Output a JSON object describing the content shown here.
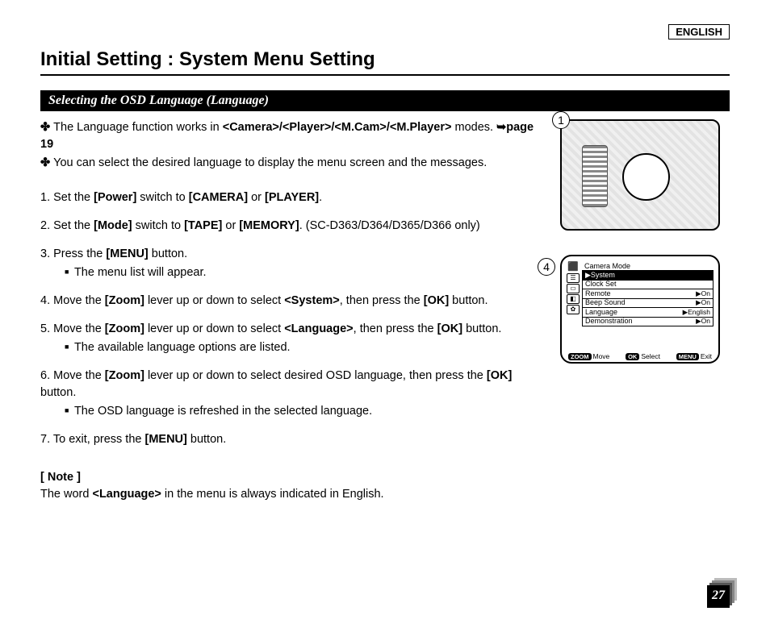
{
  "language_tag": "ENGLISH",
  "page_title": "Initial Setting : System Menu Setting",
  "section_title": "Selecting the OSD Language (Language)",
  "intro": {
    "line1_pre": "The Language function works in ",
    "line1_modes": "<Camera>/<Player>/<M.Cam>/<M.Player>",
    "line1_post": " modes. ",
    "line1_ref": "➥page 19",
    "line2": "You can select the desired language to display the menu screen and the messages."
  },
  "steps": {
    "s1": {
      "num": "1.",
      "pre": " Set the ",
      "b1": "[Power]",
      "mid": " switch to ",
      "b2": "[CAMERA]",
      "or": " or ",
      "b3": "[PLAYER]",
      "end": "."
    },
    "s2": {
      "num": "2.",
      "pre": " Set the ",
      "b1": "[Mode]",
      "mid": " switch to ",
      "b2": "[TAPE]",
      "or": " or ",
      "b3": "[MEMORY]",
      "end": ". (SC-D363/D364/D365/D366 only)"
    },
    "s3": {
      "num": "3.",
      "pre": " Press the ",
      "b1": "[MENU]",
      "end": " button.",
      "sub": "The menu list will appear."
    },
    "s4": {
      "num": "4.",
      "pre": " Move the ",
      "b1": "[Zoom]",
      "mid": " lever up or down to select ",
      "b2": "<System>",
      "post": ", then press the ",
      "b3": "[OK]",
      "end": " button."
    },
    "s5": {
      "num": "5.",
      "pre": " Move the ",
      "b1": "[Zoom]",
      "mid": " lever up or down to select ",
      "b2": "<Language>",
      "post": ", then press the ",
      "b3": "[OK]",
      "end": " button.",
      "sub": "The available language options are listed."
    },
    "s6": {
      "num": "6.",
      "pre": " Move the ",
      "b1": "[Zoom]",
      "mid": " lever up or down to select desired OSD language, then press the ",
      "b3": "[OK]",
      "end": " button.",
      "sub": "The OSD language is refreshed in the selected language."
    },
    "s7": {
      "num": "7.",
      "pre": " To exit, press the ",
      "b1": "[MENU]",
      "end": " button."
    }
  },
  "note": {
    "title": "[ Note ]",
    "pre": "The word ",
    "b": "<Language>",
    "post": " in the menu is always indicated in English."
  },
  "fig": {
    "badge1": "1",
    "badge4": "4",
    "menu": {
      "title": "Camera Mode",
      "selected": "▶System",
      "items": [
        {
          "label": "Clock Set",
          "val": ""
        },
        {
          "label": "Remote",
          "val": "▶On"
        },
        {
          "label": "Beep Sound",
          "val": "▶On"
        },
        {
          "label": "Language",
          "val": "▶English"
        },
        {
          "label": "Demonstration",
          "val": "▶On"
        }
      ],
      "foot": {
        "zoom": "ZOOM",
        "move": "Move",
        "ok": "OK",
        "select": "Select",
        "menu": "MENU",
        "exit": "Exit"
      }
    }
  },
  "page_number": "27"
}
